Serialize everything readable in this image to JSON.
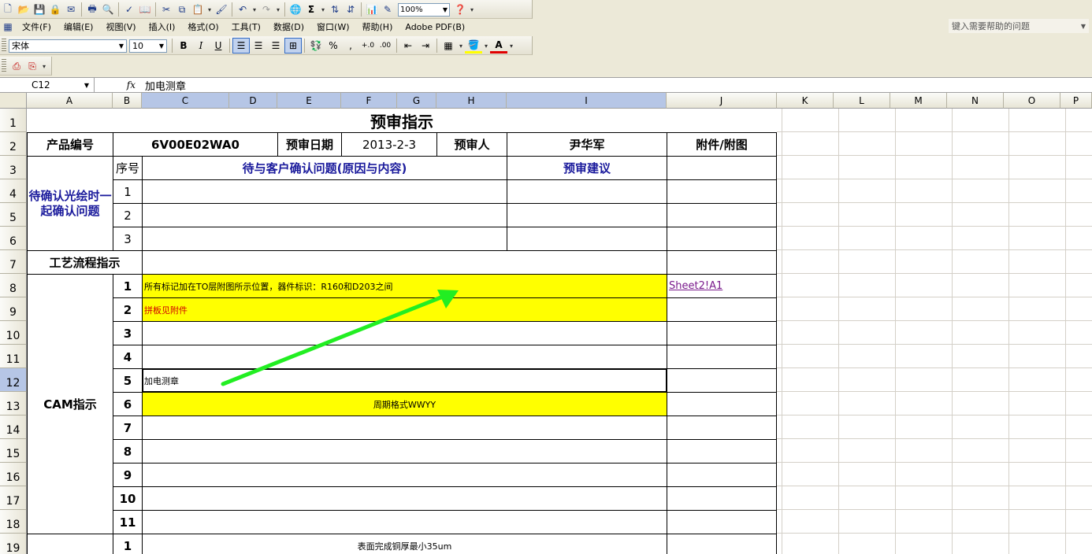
{
  "toolbar": {
    "zoom": "100%",
    "font_name": "宋体",
    "font_size": "10"
  },
  "menu": {
    "items": [
      "文件(F)",
      "编辑(E)",
      "视图(V)",
      "插入(I)",
      "格式(O)",
      "工具(T)",
      "数据(D)",
      "窗口(W)",
      "帮助(H)",
      "Adobe PDF(B)"
    ],
    "help_placeholder": "键入需要帮助的问题"
  },
  "formula_bar": {
    "cell_ref": "C12",
    "fx": "fx",
    "value": "加电测章"
  },
  "columns": [
    "A",
    "B",
    "C",
    "D",
    "E",
    "F",
    "G",
    "H",
    "I",
    "J",
    "K",
    "L",
    "M",
    "N",
    "O",
    "P"
  ],
  "rows": [
    "1",
    "2",
    "3",
    "4",
    "5",
    "6",
    "7",
    "8",
    "9",
    "10",
    "11",
    "12",
    "13",
    "14",
    "15",
    "16",
    "17",
    "18",
    "19"
  ],
  "sheet": {
    "title": "预审指示",
    "product_label": "产品编号",
    "product_value": "6V00E02WA0",
    "date_label": "预审日期",
    "date_value": "2013-2-3",
    "reviewer_label": "预审人",
    "reviewer_value": "尹华军",
    "attachment_label": "附件/附图",
    "confirm_section": "待确认光绘时一起确认问题",
    "seq_label": "序号",
    "issue_header": "待与客户确认问题(原因与内容)",
    "advice_header": "预审建议",
    "confirm_rows": [
      "1",
      "2",
      "3"
    ],
    "process_label": "工艺流程指示",
    "cam_label": "CAM指示",
    "cam_rows": [
      {
        "num": "1",
        "text": "所有标记加在TO层附图所示位置，器件标识：R160和D203之间",
        "link": "Sheet2!A1"
      },
      {
        "num": "2",
        "text": "拼板见附件"
      },
      {
        "num": "3",
        "text": ""
      },
      {
        "num": "4",
        "text": ""
      },
      {
        "num": "5",
        "text": "加电测章"
      },
      {
        "num": "6",
        "text": "周期格式WWYY"
      },
      {
        "num": "7",
        "text": ""
      },
      {
        "num": "8",
        "text": ""
      },
      {
        "num": "9",
        "text": ""
      },
      {
        "num": "10",
        "text": ""
      },
      {
        "num": "11",
        "text": ""
      }
    ],
    "next_row": {
      "num": "1",
      "text": "表面完成铜厚最小35um"
    }
  },
  "colors": {
    "highlight": "#ffff00",
    "arrow": "#22ee22",
    "label_blue": "#1a1a9c",
    "red_text": "#d00000"
  }
}
